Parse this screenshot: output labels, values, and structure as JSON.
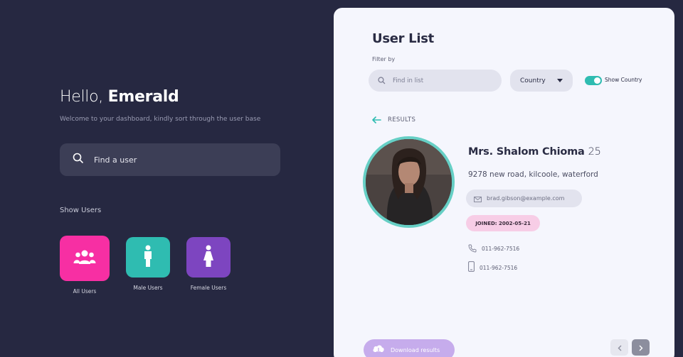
{
  "greeting": {
    "hello": "Hello,",
    "name": "Emerald"
  },
  "welcome_text": "Welcome to your dashboard, kindly sort through the user base",
  "search": {
    "placeholder": "Find a user"
  },
  "show_users": {
    "title": "Show Users",
    "categories": [
      {
        "label": "All Users",
        "icon": "users-group-icon",
        "color": "#f72fa3"
      },
      {
        "label": "Male Users",
        "icon": "male-icon",
        "color": "#2fbcb1"
      },
      {
        "label": "Female Users",
        "icon": "female-icon",
        "color": "#7d45c0"
      }
    ]
  },
  "user_list": {
    "title": "User List",
    "filter_by": "Filter by",
    "search_placeholder": "Find in list",
    "country_select": "Country",
    "show_country_label": "Show Country",
    "show_country_on": true,
    "results_label": "RESULTS"
  },
  "user": {
    "name": "Mrs. Shalom Chioma",
    "age": "25",
    "address": "9278 new road, kilcoole, waterford",
    "email": "brad.gibson@example.com",
    "joined": "JOINED: 2002-05-21",
    "phone": "011-962-7516",
    "cell": "011-962-7516"
  },
  "footer": {
    "download_label": "Download results"
  },
  "colors": {
    "background": "#262841",
    "panel": "#f5f6fd",
    "accent_teal": "#2fbcb1",
    "accent_pink": "#f72fa3",
    "accent_purple": "#7d45c0"
  }
}
